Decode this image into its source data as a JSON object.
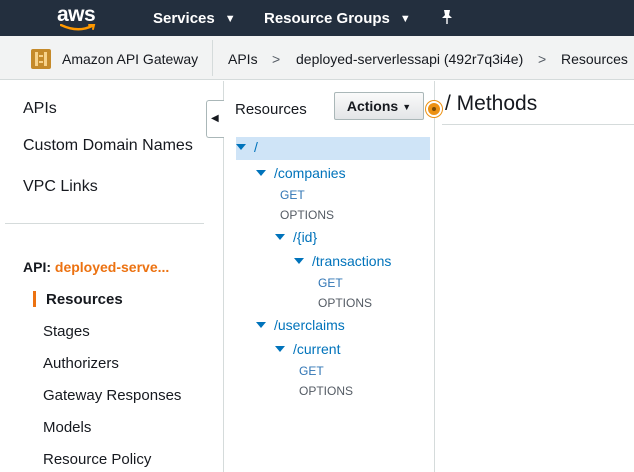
{
  "topnav": {
    "logo": "aws",
    "services_label": "Services",
    "resource_groups_label": "Resource Groups",
    "pin_icon": "pushpin-icon"
  },
  "breadcrumb": {
    "service": "Amazon API Gateway",
    "service_icon": "api-gateway-icon",
    "apis": "APIs",
    "api": "deployed-serverlessapi (492r7q3i4e)",
    "section": "Resources",
    "separator": ">"
  },
  "sidebar": {
    "top_items": [
      "APIs",
      "Custom Domain Names",
      "VPC Links"
    ],
    "api_prefix": "API:",
    "api_name": "deployed-serve...",
    "sub_items": [
      "Resources",
      "Stages",
      "Authorizers",
      "Gateway Responses",
      "Models",
      "Resource Policy"
    ]
  },
  "resources": {
    "title": "Resources",
    "actions_label": "Actions",
    "tree": [
      {
        "kind": "node",
        "label": "/",
        "selected": true
      },
      {
        "kind": "node",
        "label": "/companies"
      },
      {
        "kind": "method",
        "label": "GET"
      },
      {
        "kind": "method",
        "label": "OPTIONS"
      },
      {
        "kind": "node",
        "label": "/{id}"
      },
      {
        "kind": "node",
        "label": "/transactions"
      },
      {
        "kind": "method",
        "label": "GET"
      },
      {
        "kind": "method",
        "label": "OPTIONS"
      },
      {
        "kind": "node",
        "label": "/userclaims"
      },
      {
        "kind": "node",
        "label": "/current"
      },
      {
        "kind": "method",
        "label": "GET"
      },
      {
        "kind": "method",
        "label": "OPTIONS"
      }
    ]
  },
  "methods_panel": {
    "title": "/ Methods"
  },
  "colors": {
    "nav_bg": "#232f3e",
    "accent_orange": "#ec7211",
    "link_blue": "#0073bb",
    "selected_row": "#cfe4f7"
  }
}
